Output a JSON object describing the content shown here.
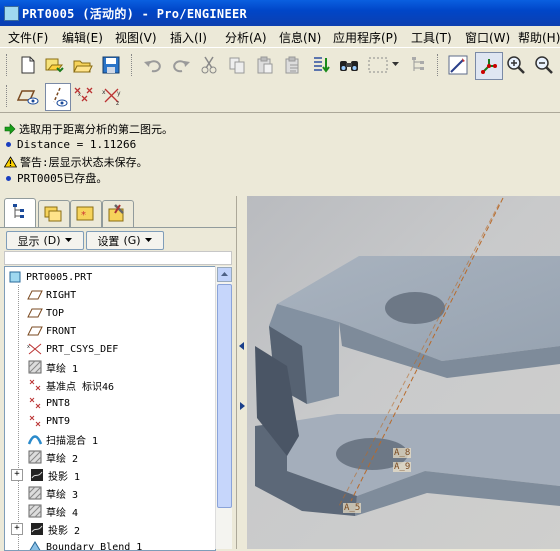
{
  "window": {
    "title": "PRT0005 (活动的) - Pro/ENGINEER"
  },
  "menu": [
    "文件(F)",
    "编辑(E)",
    "视图(V)",
    "插入(I)",
    "分析(A)",
    "信息(N)",
    "应用程序(P)",
    "工具(T)",
    "窗口(W)",
    "帮助(H)"
  ],
  "toolbar": {
    "icons": [
      "new-icon",
      "open-folder-icon",
      "open-icon",
      "save-icon",
      "undo-icon",
      "redo-icon",
      "cut-icon",
      "copy-icon",
      "paste-icon",
      "paste-special-icon",
      "regenerate-icon",
      "find-icon",
      "select-box-icon",
      "model-tree-icon",
      "repaint-icon",
      "orient-icon",
      "zoom-in-icon",
      "zoom-out-icon"
    ],
    "row2_icons": [
      "datum-plane-display-icon",
      "datum-axis-display-icon",
      "datum-point-display-icon",
      "coordinate-system-display-icon"
    ]
  },
  "messages": [
    {
      "type": "prompt",
      "text": "选取用于距离分析的第二图元。"
    },
    {
      "type": "info",
      "text": "Distance = 1.11266"
    },
    {
      "type": "warning",
      "text": "警告:层显示状态未保存。"
    },
    {
      "type": "info",
      "text": "PRT0005已存盘。"
    }
  ],
  "panel": {
    "show_label": "显示",
    "show_key": "(D)",
    "settings_label": "设置",
    "settings_key": "(G)"
  },
  "tree": [
    {
      "label": "PRT0005.PRT",
      "icon": "part-icon",
      "expand": ""
    },
    {
      "label": "RIGHT",
      "icon": "datum-plane-icon",
      "expand": ""
    },
    {
      "label": "TOP",
      "icon": "datum-plane-icon",
      "expand": ""
    },
    {
      "label": "FRONT",
      "icon": "datum-plane-icon",
      "expand": ""
    },
    {
      "label": "PRT_CSYS_DEF",
      "icon": "csys-icon",
      "expand": ""
    },
    {
      "label": "草绘 1",
      "icon": "sketch-icon",
      "expand": ""
    },
    {
      "label": "基准点 标识46",
      "icon": "datum-point-icon",
      "expand": ""
    },
    {
      "label": "PNT8",
      "icon": "datum-point-icon",
      "expand": ""
    },
    {
      "label": "PNT9",
      "icon": "datum-point-icon",
      "expand": ""
    },
    {
      "label": "扫描混合 1",
      "icon": "swept-blend-icon",
      "expand": ""
    },
    {
      "label": "草绘 2",
      "icon": "sketch-icon",
      "expand": ""
    },
    {
      "label": "投影 1",
      "icon": "projection-icon",
      "expand": "+"
    },
    {
      "label": "草绘 3",
      "icon": "sketch-icon",
      "expand": ""
    },
    {
      "label": "草绘 4",
      "icon": "sketch-icon",
      "expand": ""
    },
    {
      "label": "投影 2",
      "icon": "projection-icon",
      "expand": "+"
    },
    {
      "label": "Boundary Blend 1",
      "icon": "boundary-blend-icon",
      "expand": ""
    }
  ],
  "graphics": {
    "labels": [
      "A_8",
      "A_9",
      "A_5"
    ]
  }
}
